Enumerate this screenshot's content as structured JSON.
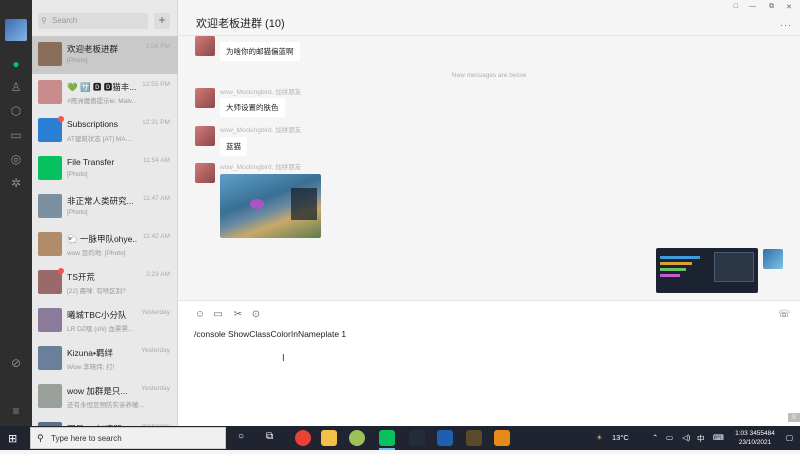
{
  "sidebar": {
    "search_placeholder": "Search",
    "plus": "+",
    "chats": [
      {
        "name": "欢迎老板进群",
        "time": "1:06 PM",
        "preview": "[Photo]",
        "active": true,
        "unread": false
      },
      {
        "name": "💚 🈂️ 🅳 🅳猫丰...",
        "time": "12:55 PM",
        "preview": "#鹰洲魔兽提示le: Malv...",
        "active": false,
        "unread": false
      },
      {
        "name": "Subscriptions",
        "time": "12:31 PM",
        "preview": "AT建筑状态 [AT] MA...",
        "active": false,
        "unread": true
      },
      {
        "name": "File Transfer",
        "time": "11:54 AM",
        "preview": "[Photo]",
        "active": false,
        "unread": false
      },
      {
        "name": "非正常人类研究...",
        "time": "11:47 AM",
        "preview": "[Photo]",
        "active": false,
        "unread": false
      },
      {
        "name": "🐑 一脉甲队ohye...",
        "time": "11:42 AM",
        "preview": "wow  目的地: [Photo]",
        "active": false,
        "unread": false
      },
      {
        "name": "TS开荒",
        "time": "2:23 AM",
        "preview": "[22] 晨咪: 有啥区别?",
        "active": false,
        "unread": true
      },
      {
        "name": "曦城TBC小分队",
        "time": "Yesterday",
        "preview": "LR DZ嘿 (shi) 血票票...",
        "active": false,
        "unread": false
      },
      {
        "name": "Kizuna•羁绊",
        "time": "Yesterday",
        "preview": "Wow  李晓炜: 打!",
        "active": false,
        "unread": false
      },
      {
        "name": "wow 加群是只...",
        "time": "Yesterday",
        "preview": "还有永恒豆预防实亲养暖...",
        "active": false,
        "unread": false
      },
      {
        "name": "网易UU加速器",
        "time": "Yesterday",
        "preview": "",
        "active": false,
        "unread": false
      }
    ]
  },
  "chat": {
    "title": "欢迎老板进群 (10)",
    "window_controls": [
      "□",
      "—",
      "⧉",
      "✕"
    ],
    "more": "···",
    "divider": "New messages are below",
    "messages": [
      {
        "sender": "",
        "text": "为啥你的邮猫偏蓝啊"
      },
      {
        "sender": "wow_Mockingbird. 加拼朋友",
        "text": "大师设置的肤色"
      },
      {
        "sender": "wow_Mockingbird. 加拼朋友",
        "text": "蓝猫"
      },
      {
        "sender": "wow_Mockingbird. 加拼朋友",
        "text": ""
      }
    ]
  },
  "composer": {
    "text": "/console ShowClassColorInNameplate 1",
    "send_hint": "S"
  },
  "taskbar": {
    "search_text": "Type here to search",
    "temperature": "13°C",
    "ime": "中",
    "time": "1:03",
    "date": "23/10/2021",
    "overlay_number": "3455484"
  },
  "colors": {
    "rail": "#2e2e2e",
    "list_bg": "#e9e9e9",
    "active_row": "#c9c9c9",
    "accent_green": "#07c160",
    "unread_red": "#fa5151",
    "taskbar": "#1f2430"
  }
}
